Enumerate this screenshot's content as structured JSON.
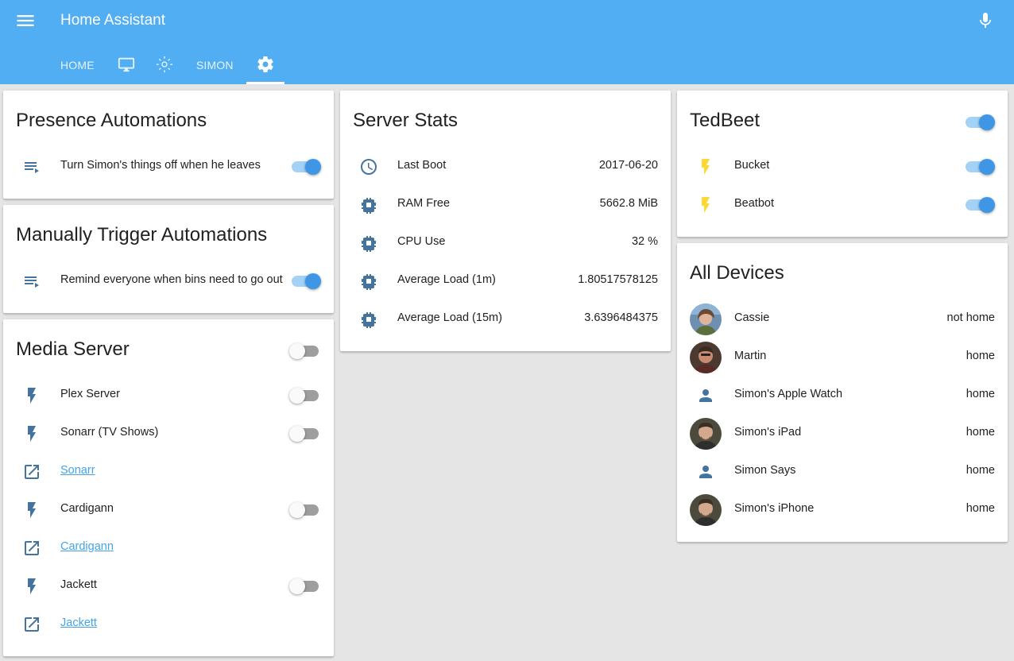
{
  "header": {
    "title": "Home Assistant",
    "tabs": [
      {
        "label": "HOME",
        "icon": null
      },
      {
        "label": "",
        "icon": "monitor-icon"
      },
      {
        "label": "",
        "icon": "brightness-icon"
      },
      {
        "label": "SIMON",
        "icon": null
      },
      {
        "label": "",
        "icon": "settings-icon",
        "active": true
      }
    ]
  },
  "colors": {
    "header": "#51aef3",
    "accent": "#3f96e5",
    "state_icon": "#44739e",
    "bolt_active": "#fdd835",
    "link": "#45a4e8"
  },
  "presence": {
    "title": "Presence Automations",
    "items": [
      {
        "label": "Turn Simon's things off when he leaves",
        "icon": "playlist-play-icon",
        "on": true
      }
    ]
  },
  "manual": {
    "title": "Manually Trigger Automations",
    "items": [
      {
        "label": "Remind everyone when bins need to go out",
        "icon": "playlist-play-icon",
        "on": true
      }
    ]
  },
  "media": {
    "title": "Media Server",
    "on": false,
    "items": [
      {
        "label": "Plex Server",
        "icon": "flash-icon",
        "on": false
      },
      {
        "label": "Sonarr (TV Shows)",
        "icon": "flash-icon",
        "on": false
      },
      {
        "label": "Sonarr",
        "icon": "open-in-new-icon",
        "link": true
      },
      {
        "label": "Cardigann",
        "icon": "flash-icon",
        "on": false
      },
      {
        "label": "Cardigann",
        "icon": "open-in-new-icon",
        "link": true
      },
      {
        "label": "Jackett",
        "icon": "flash-icon",
        "on": false
      },
      {
        "label": "Jackett",
        "icon": "open-in-new-icon",
        "link": true
      }
    ]
  },
  "server": {
    "title": "Server Stats",
    "items": [
      {
        "label": "Last Boot",
        "value": "2017-06-20",
        "icon": "clock-icon"
      },
      {
        "label": "RAM Free",
        "value": "5662.8 MiB",
        "icon": "chip-icon"
      },
      {
        "label": "CPU Use",
        "value": "32 %",
        "icon": "chip-icon"
      },
      {
        "label": "Average Load (1m)",
        "value": "1.80517578125",
        "icon": "chip-icon"
      },
      {
        "label": "Average Load (15m)",
        "value": "3.6396484375",
        "icon": "chip-icon"
      }
    ]
  },
  "tedbeet": {
    "title": "TedBeet",
    "on": true,
    "items": [
      {
        "label": "Bucket",
        "icon": "flash-icon",
        "on": true
      },
      {
        "label": "Beatbot",
        "icon": "flash-icon",
        "on": true
      }
    ]
  },
  "devices": {
    "title": "All Devices",
    "items": [
      {
        "label": "Cassie",
        "value": "not home",
        "avatar": "photo"
      },
      {
        "label": "Martin",
        "value": "home",
        "avatar": "photo"
      },
      {
        "label": "Simon's Apple Watch",
        "value": "home",
        "avatar": "account-icon"
      },
      {
        "label": "Simon's iPad",
        "value": "home",
        "avatar": "photo"
      },
      {
        "label": "Simon Says",
        "value": "home",
        "avatar": "account-icon"
      },
      {
        "label": "Simon's iPhone",
        "value": "home",
        "avatar": "photo"
      }
    ]
  }
}
